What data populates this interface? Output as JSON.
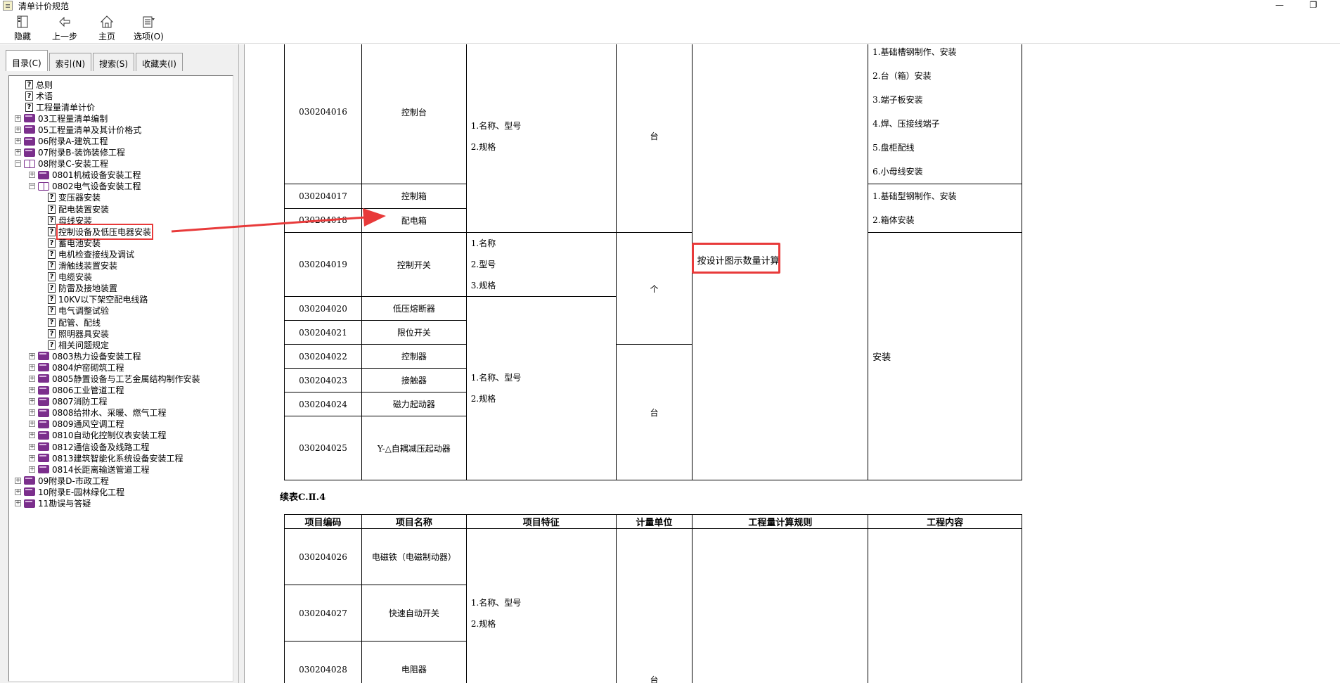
{
  "window": {
    "title": "清单计价规范",
    "minimize": "—",
    "restore": "❐"
  },
  "toolbar": {
    "hide": "隐藏",
    "back": "上一步",
    "home": "主页",
    "options": "选项(O)"
  },
  "tabs": [
    "目录(C)",
    "索引(N)",
    "搜索(S)",
    "收藏夹(I)"
  ],
  "tree": [
    {
      "label": "总则",
      "level": 1,
      "icon": "doc"
    },
    {
      "label": "术语",
      "level": 1,
      "icon": "doc"
    },
    {
      "label": "工程量清单计价",
      "level": 1,
      "icon": "doc"
    },
    {
      "label": "03工程量清单编制",
      "level": 0,
      "icon": "book",
      "exp": "+"
    },
    {
      "label": "05工程量清单及其计价格式",
      "level": 0,
      "icon": "book",
      "exp": "+"
    },
    {
      "label": "06附录A-建筑工程",
      "level": 0,
      "icon": "book",
      "exp": "+"
    },
    {
      "label": "07附录B-装饰装修工程",
      "level": 0,
      "icon": "book",
      "exp": "+"
    },
    {
      "label": "08附录C-安装工程",
      "level": 0,
      "icon": "openbook",
      "exp": "−"
    },
    {
      "label": "0801机械设备安装工程",
      "level": 1,
      "icon": "book",
      "exp": "+"
    },
    {
      "label": "0802电气设备安装工程",
      "level": 1,
      "icon": "openbook",
      "exp": "−"
    },
    {
      "label": "变压器安装",
      "level": 3,
      "icon": "doc"
    },
    {
      "label": "配电装置安装",
      "level": 3,
      "icon": "doc"
    },
    {
      "label": "母线安装",
      "level": 3,
      "icon": "doc"
    },
    {
      "label": "控制设备及低压电器安装",
      "level": 3,
      "icon": "doc",
      "highlight": true
    },
    {
      "label": "蓄电池安装",
      "level": 3,
      "icon": "doc"
    },
    {
      "label": "电机检查接线及调试",
      "level": 3,
      "icon": "doc"
    },
    {
      "label": "滑触线装置安装",
      "level": 3,
      "icon": "doc"
    },
    {
      "label": "电缆安装",
      "level": 3,
      "icon": "doc"
    },
    {
      "label": "防雷及接地装置",
      "level": 3,
      "icon": "doc"
    },
    {
      "label": "10KV以下架空配电线路",
      "level": 3,
      "icon": "doc"
    },
    {
      "label": "电气调整试验",
      "level": 3,
      "icon": "doc"
    },
    {
      "label": "配管、配线",
      "level": 3,
      "icon": "doc"
    },
    {
      "label": "照明器具安装",
      "level": 3,
      "icon": "doc"
    },
    {
      "label": "相关问题规定",
      "level": 3,
      "icon": "doc"
    },
    {
      "label": "0803热力设备安装工程",
      "level": 1,
      "icon": "book",
      "exp": "+"
    },
    {
      "label": "0804炉窑砌筑工程",
      "level": 1,
      "icon": "book",
      "exp": "+"
    },
    {
      "label": "0805静置设备与工艺金属结构制作安装",
      "level": 1,
      "icon": "book",
      "exp": "+"
    },
    {
      "label": "0806工业管道工程",
      "level": 1,
      "icon": "book",
      "exp": "+"
    },
    {
      "label": "0807消防工程",
      "level": 1,
      "icon": "book",
      "exp": "+"
    },
    {
      "label": "0808给排水、采暖、燃气工程",
      "level": 1,
      "icon": "book",
      "exp": "+"
    },
    {
      "label": "0809通风空调工程",
      "level": 1,
      "icon": "book",
      "exp": "+"
    },
    {
      "label": "0810自动化控制仪表安装工程",
      "level": 1,
      "icon": "book",
      "exp": "+"
    },
    {
      "label": "0812通信设备及线路工程",
      "level": 1,
      "icon": "book",
      "exp": "+"
    },
    {
      "label": "0813建筑智能化系统设备安装工程",
      "level": 1,
      "icon": "book",
      "exp": "+"
    },
    {
      "label": "0814长距离输送管道工程",
      "level": 1,
      "icon": "book",
      "exp": "+"
    },
    {
      "label": "09附录D-市政工程",
      "level": 0,
      "icon": "book",
      "exp": "+"
    },
    {
      "label": "10附录E-园林绿化工程",
      "level": 0,
      "icon": "book",
      "exp": "+"
    },
    {
      "label": "11勘误与答疑",
      "level": 0,
      "icon": "book",
      "exp": "+"
    }
  ],
  "table1": {
    "rows": [
      {
        "code": "030204016",
        "name": "控制台"
      },
      {
        "code": "030204017",
        "name": "控制箱"
      },
      {
        "code": "030204018",
        "name": "配电箱"
      },
      {
        "code": "030204019",
        "name": "控制开关"
      },
      {
        "code": "030204020",
        "name": "低压熔断器"
      },
      {
        "code": "030204021",
        "name": "限位开关"
      },
      {
        "code": "030204022",
        "name": "控制器"
      },
      {
        "code": "030204023",
        "name": "接触器"
      },
      {
        "code": "030204024",
        "name": "磁力起动器"
      },
      {
        "code": "030204025",
        "name": "Y-△自耦减压起动器"
      }
    ],
    "feat_a": [
      "1.名称、型号",
      "2.规格"
    ],
    "feat_b": [
      "1.名称",
      "2.型号",
      "3.规格"
    ],
    "feat_c": [
      "1.名称、型号",
      "2.规格"
    ],
    "unit_tai": "台",
    "unit_ge": "个",
    "unit_tai2": "台",
    "rule": "按设计图示数量计算",
    "work_a": [
      "1.基础槽钢制作、安装",
      "2.台（箱）安装",
      "3.端子板安装",
      "4.焊、压接线端子",
      "5.盘柜配线",
      "6.小母线安装"
    ],
    "work_b": [
      "1.基础型钢制作、安装",
      "2.箱体安装"
    ],
    "work_c": "安装"
  },
  "caption2": "续表C.Ⅱ.4",
  "table2": {
    "headers": [
      "项目编码",
      "项目名称",
      "项目特征",
      "计量单位",
      "工程量计算规则",
      "工程内容"
    ],
    "rows": [
      {
        "code": "030204026",
        "name": "电磁铁（电磁制动器）"
      },
      {
        "code": "030204027",
        "name": "快速自动开关"
      },
      {
        "code": "030204028",
        "name": "电阻器"
      }
    ],
    "feat": [
      "1.名称、型号",
      "2.规格"
    ],
    "unit": "台"
  }
}
